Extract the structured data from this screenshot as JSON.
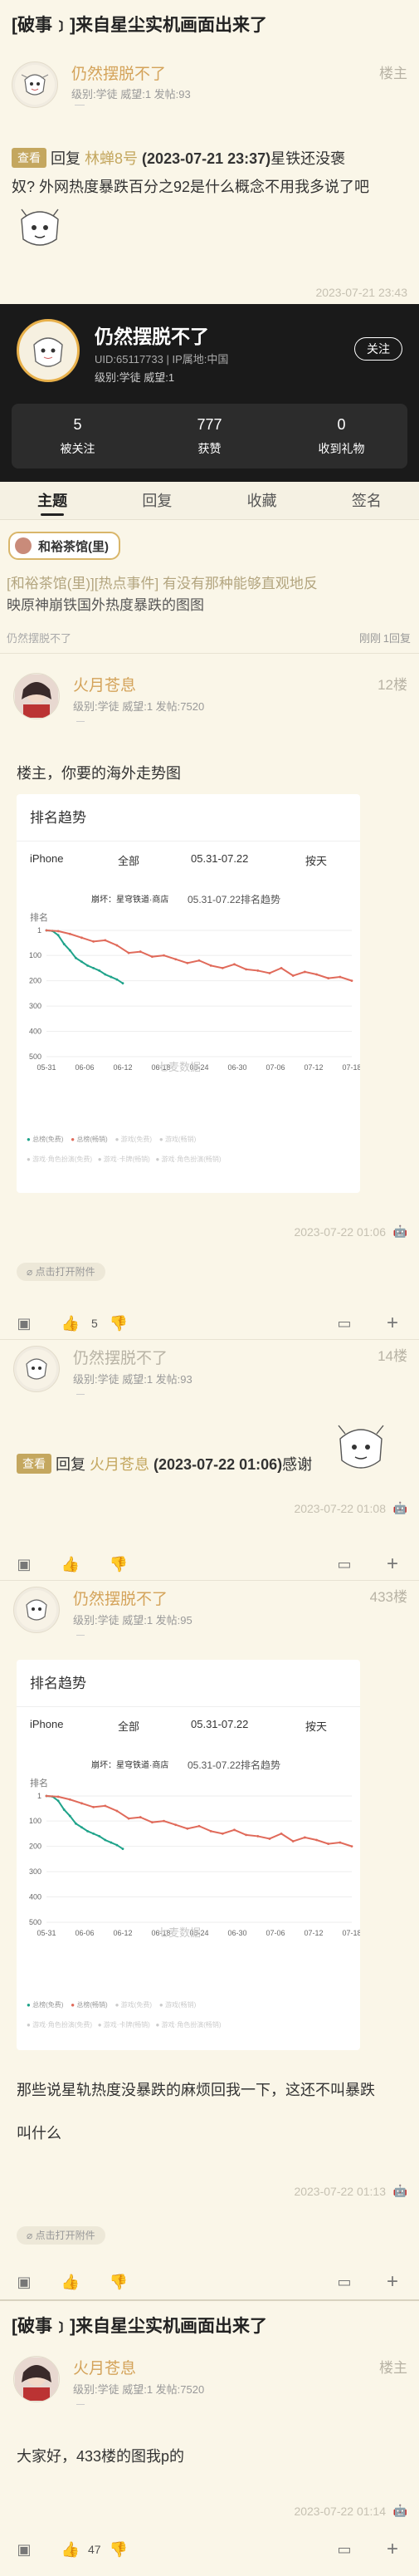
{
  "thread": {
    "title": "[破事﹞]来自星尘实机画面出来了",
    "footer_title": "[破事﹞]来自星尘实机画面出来了"
  },
  "op": {
    "name": "仍然摆脱不了",
    "badge": "楼主",
    "meta": "级别:学徒 威望:1 发帖:93",
    "quote_tag": "查看",
    "reply_word": "回复",
    "reply_to": "林蝉8号",
    "reply_time": "(2023-07-21 23:37)",
    "reply_text_1": "星铁还没褒",
    "reply_text_2": "奴? 外网热度暴跌百分之92是什么概念不用我多说了吧",
    "time": "2023-07-21 23:43"
  },
  "profile": {
    "name": "仍然摆脱不了",
    "uid_line": "UID:65117733 | IP属地:中国",
    "level_line": "级别:学徒  威望:1",
    "follow_label": "关注",
    "stats": [
      {
        "n": "5",
        "label": "被关注"
      },
      {
        "n": "777",
        "label": "获赞"
      },
      {
        "n": "0",
        "label": "收到礼物"
      }
    ]
  },
  "tabs": [
    "主题",
    "回复",
    "收藏",
    "签名"
  ],
  "forum": {
    "name": "和裕茶馆(里)",
    "thread_line_1": "[和裕茶馆(里)][热点事件] 有没有那种能够直观地反",
    "thread_line_2": "映原神崩铁国外热度暴跌的图图",
    "author": "仍然摆脱不了",
    "when": "刚刚",
    "replies": "1回复"
  },
  "posts": [
    {
      "name": "火月苍息",
      "meta": "级别:学徒 威望:1 发帖:7520",
      "floor": "12楼",
      "text": "楼主，你要的海外走势图",
      "time": "2023-07-22 01:06",
      "attach": "点击打开附件",
      "likes": "5"
    },
    {
      "name": "仍然摆脱不了",
      "meta": "级别:学徒 威望:1 发帖:93",
      "floor": "14楼",
      "quote_tag": "查看",
      "reply_word": "回复",
      "reply_to": "火月苍息",
      "reply_time": "(2023-07-22 01:06)",
      "reply_text": "感谢",
      "time": "2023-07-22 01:08"
    },
    {
      "name": "仍然摆脱不了",
      "meta": "级别:学徒 威望:1 发帖:95",
      "floor": "433楼",
      "text_1": "那些说星轨热度没暴跌的麻烦回我一下，这还不叫暴跌",
      "text_2": "叫什么",
      "time": "2023-07-22 01:13",
      "attach": "点击打开附件"
    },
    {
      "name": "火月苍息",
      "meta": "级别:学徒 威望:1 发帖:7520",
      "badge": "楼主",
      "text": "大家好，433楼的图我p的",
      "time": "2023-07-22 01:14",
      "likes": "47"
    }
  ],
  "rank_chart": {
    "title": "排名趋势",
    "platform": "iPhone",
    "scope": "全部",
    "date_range": "05.31-07.22",
    "granularity": "按天",
    "inner_app": "崩坏：星穹铁道·商店",
    "inner_title": "05.31-07.22排名趋势",
    "y_axis_name": "排名",
    "watermark": "七麦数据",
    "legend_1": "总榜(免费)",
    "legend_2": "总榜(畅销)",
    "legend_3": "游戏(免费)",
    "legend_4": "游戏(畅销)",
    "legend_5": "游戏·角色扮演(免费)",
    "legend_6": "游戏·卡牌(畅销)",
    "legend_7": "游戏·角色扮演(畅销)",
    "legend_8": "游戏·角色扮演(畅销)"
  },
  "chart_data": {
    "type": "line",
    "title": "05.31-07.22排名趋势",
    "ylabel": "排名",
    "x_ticks": [
      "05-31",
      "06-06",
      "06-12",
      "06-18",
      "06-24",
      "06-30",
      "07-06",
      "07-12",
      "07-18"
    ],
    "y_ticks": [
      1,
      100,
      200,
      300,
      400,
      500
    ],
    "ylim": [
      1,
      500
    ],
    "y_inverted": true,
    "series": [
      {
        "name": "总榜(免费)",
        "color": "#1fa38a",
        "x": [
          0,
          1,
          2,
          3,
          4,
          5,
          6,
          7,
          8,
          9,
          10,
          11,
          12,
          13
        ],
        "y": [
          1,
          3,
          20,
          55,
          80,
          110,
          125,
          140,
          150,
          160,
          175,
          185,
          195,
          210
        ]
      },
      {
        "name": "总榜(畅销)",
        "color": "#e06a5a",
        "x": [
          0,
          2,
          4,
          6,
          8,
          10,
          12,
          14,
          16,
          18,
          20,
          22,
          24,
          26,
          28,
          30,
          32,
          34,
          36,
          38,
          40,
          42,
          44,
          46,
          48,
          50,
          52
        ],
        "y": [
          1,
          4,
          15,
          30,
          45,
          40,
          60,
          90,
          85,
          105,
          100,
          115,
          130,
          120,
          140,
          150,
          135,
          155,
          160,
          170,
          150,
          180,
          165,
          175,
          190,
          185,
          200
        ]
      }
    ],
    "x_max": 52
  },
  "icons": [
    "gift-icon",
    "thumb-up-icon",
    "thumb-down-icon",
    "comment-icon",
    "plus-icon",
    "paperclip-icon",
    "android-icon"
  ]
}
